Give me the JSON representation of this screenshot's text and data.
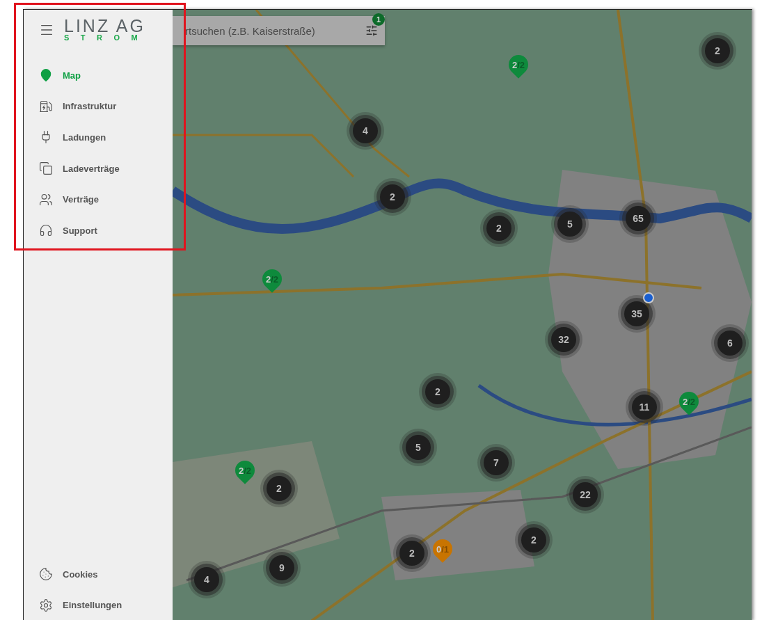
{
  "logo": {
    "name": "LINZ AG",
    "sub": "STROM"
  },
  "nav": [
    {
      "kind": "map",
      "label": "Map",
      "selected": true
    },
    {
      "kind": "station",
      "label": "Infrastruktur",
      "selected": false
    },
    {
      "kind": "plug",
      "label": "Ladungen",
      "selected": false
    },
    {
      "kind": "docs",
      "label": "Ladeverträge",
      "selected": false
    },
    {
      "kind": "people",
      "label": "Verträge",
      "selected": false
    },
    {
      "kind": "support",
      "label": "Support",
      "selected": false
    }
  ],
  "footer_nav": [
    {
      "kind": "cookie",
      "label": "Cookies"
    },
    {
      "kind": "settings",
      "label": "Einstellungen"
    }
  ],
  "search": {
    "placeholder": "rtsuchen (z.B. Kaiserstraße)",
    "filter_count": "1"
  },
  "clusters": [
    "2",
    "4",
    "2",
    "2",
    "5",
    "65",
    "35",
    "32",
    "6",
    "2",
    "11",
    "5",
    "7",
    "2",
    "22",
    "2",
    "2",
    "9",
    "4"
  ],
  "pins": [
    {
      "available": "2",
      "total": "/2",
      "color": "#0e8a3c"
    },
    {
      "available": "2",
      "total": "/2",
      "color": "#0e8a3c"
    },
    {
      "available": "2",
      "total": "/2",
      "color": "#0e8a3c"
    },
    {
      "available": "2",
      "total": "/2",
      "color": "#0e8a3c"
    },
    {
      "available": "0",
      "total": "/1",
      "color": "#c87400"
    }
  ]
}
